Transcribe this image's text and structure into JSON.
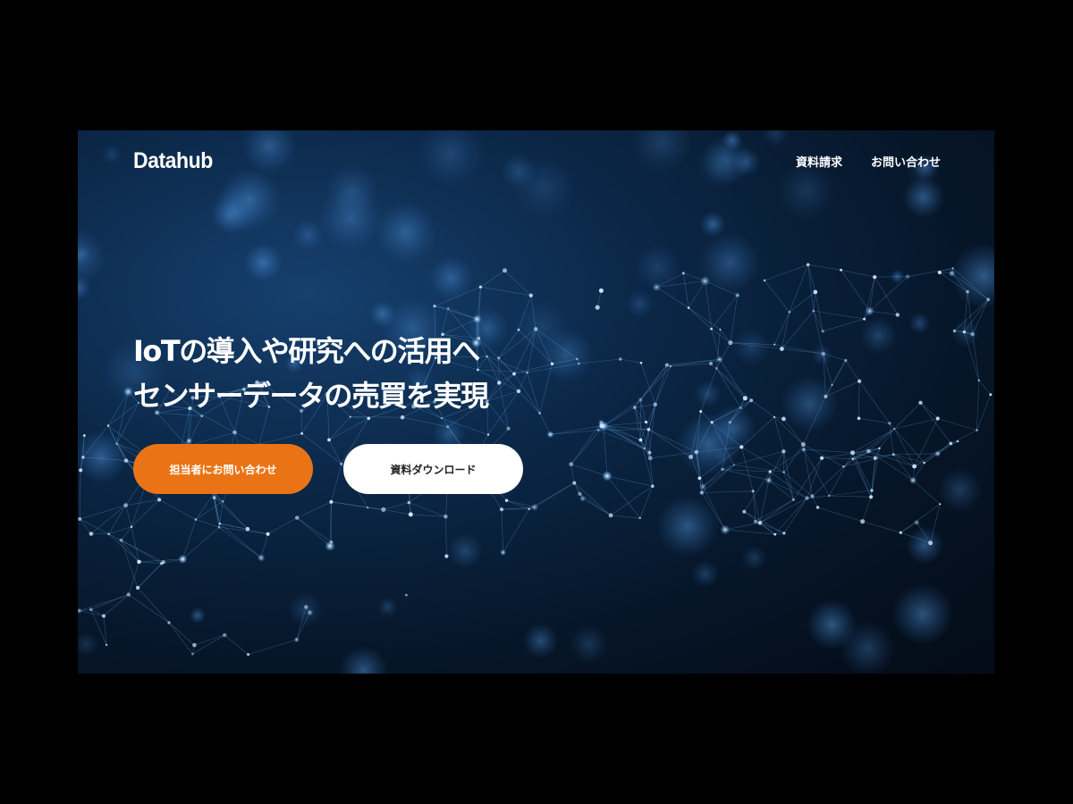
{
  "header": {
    "logo": "Datahub",
    "nav": {
      "docs_label": "資料請求",
      "contact_label": "お問い合わせ"
    }
  },
  "hero": {
    "title_line1": "IoTの導入や研究への活用へ",
    "title_line2": "センサーデータの売買を実現",
    "primary_button": "担当者にお問い合わせ",
    "secondary_button": "資料ダウンロード"
  },
  "colors": {
    "primary_button_bg": "#ea7415",
    "secondary_button_bg": "#ffffff",
    "background_dark": "#061527",
    "background_blue": "#16406e"
  }
}
